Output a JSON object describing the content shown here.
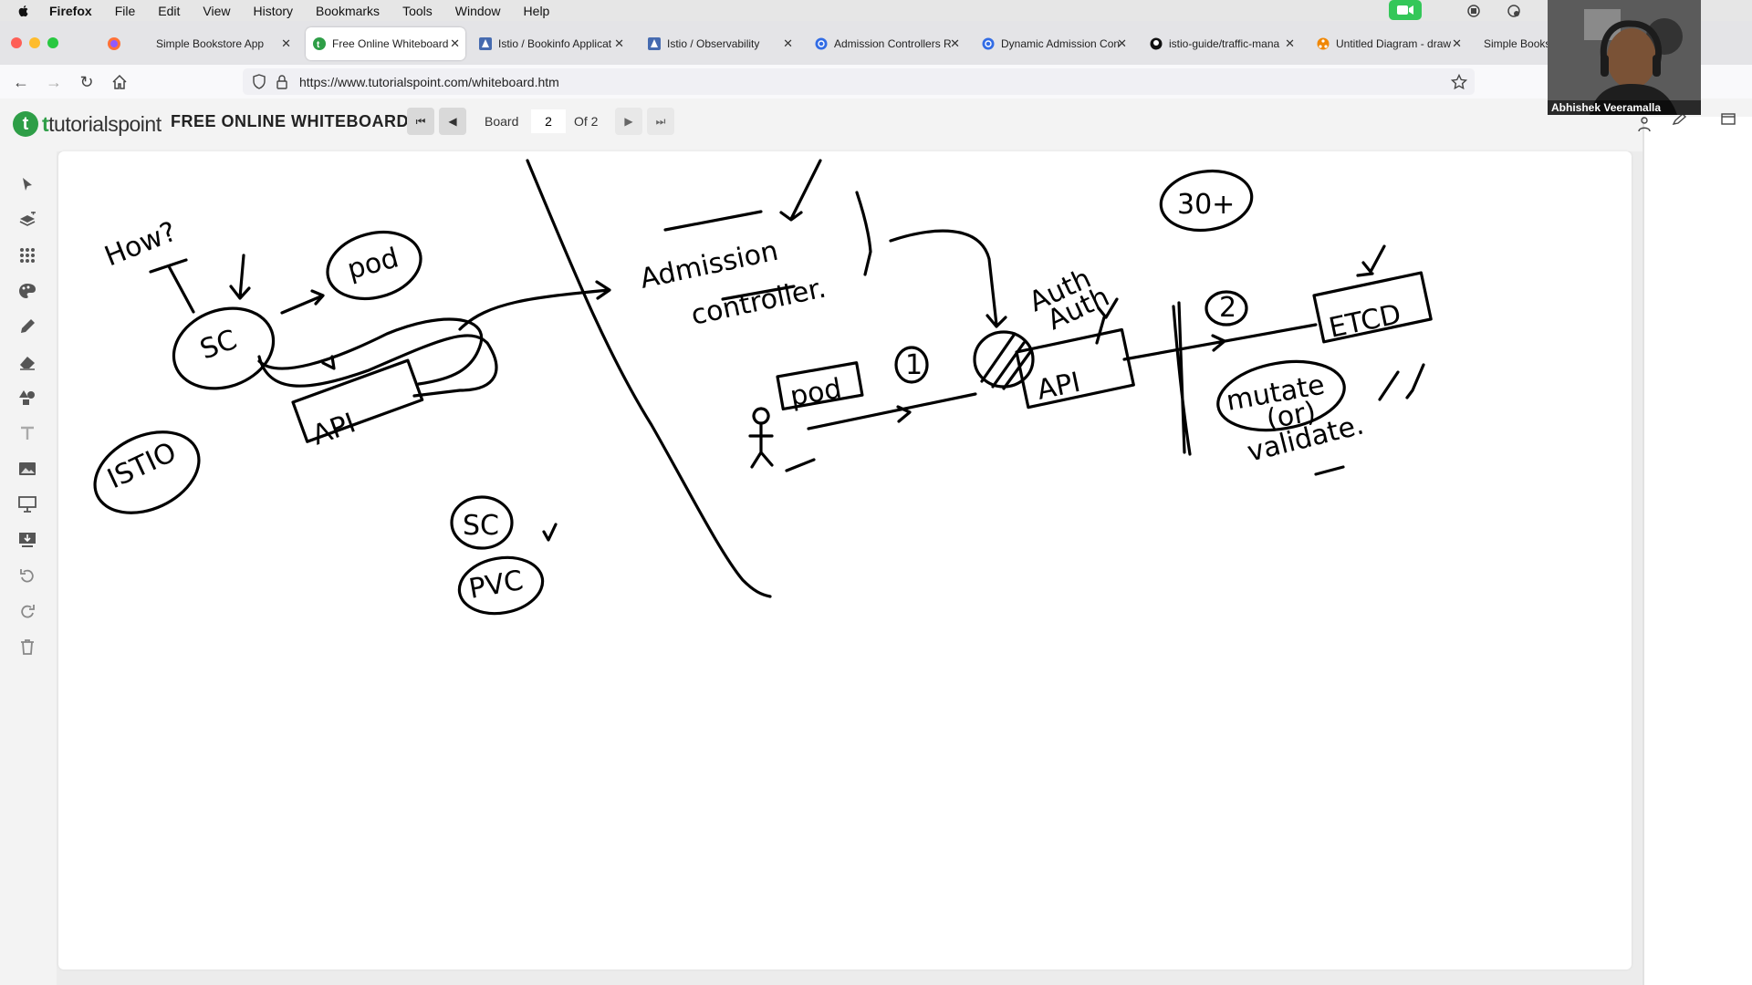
{
  "menubar": {
    "items": [
      "Firefox",
      "File",
      "Edit",
      "View",
      "History",
      "Bookmarks",
      "Tools",
      "Window",
      "Help"
    ]
  },
  "tabs": [
    {
      "title": "Simple Bookstore App",
      "icon": "firefox-icon",
      "active": false
    },
    {
      "title": "Free Online Whiteboard",
      "icon": "tutorialspoint-icon",
      "active": true
    },
    {
      "title": "Istio / Bookinfo Applicat",
      "icon": "istio-icon",
      "active": false
    },
    {
      "title": "Istio / Observability",
      "icon": "istio-icon",
      "active": false
    },
    {
      "title": "Admission Controllers R",
      "icon": "kubernetes-icon",
      "active": false
    },
    {
      "title": "Dynamic Admission Con",
      "icon": "kubernetes-icon",
      "active": false
    },
    {
      "title": "istio-guide/traffic-mana",
      "icon": "github-icon",
      "active": false
    },
    {
      "title": "Untitled Diagram - draw",
      "icon": "drawio-icon",
      "active": false
    },
    {
      "title": "Simple Books",
      "icon": "",
      "active": false
    }
  ],
  "navbar": {
    "url": "https://www.tutorialspoint.com/whiteboard.htm"
  },
  "whiteboard": {
    "logo_text": "tutorialspoint",
    "title": "FREE ONLINE WHITEBOARD",
    "board_label": "Board",
    "board_number": "2",
    "of_label": "Of 2",
    "tools": [
      "pointer-icon",
      "layers-icon",
      "grid-icon",
      "palette-icon",
      "pencil-icon",
      "eraser-icon",
      "shapes-icon",
      "text-icon",
      "image-icon",
      "presentation-icon",
      "download-icon",
      "undo-icon",
      "redo-icon",
      "trash-icon"
    ]
  },
  "drawing": {
    "labels": {
      "how": "How?",
      "pod1": "pod",
      "sc1": "SC",
      "api1": "API",
      "istio": "ISTIO",
      "sc2": "SC",
      "pvc": "PVC",
      "admission": "Admission",
      "controller": "controller.",
      "pod2": "pod",
      "step1": "1",
      "auth1": "Auth",
      "auth2": "Auth",
      "api2": "API",
      "step2": "2",
      "etcd": "ETCD",
      "thirty": "30+",
      "mutate": "mutate",
      "or": "(or)",
      "validate": "validate."
    }
  },
  "webcam": {
    "name": "Abhishek Veeramalla"
  }
}
